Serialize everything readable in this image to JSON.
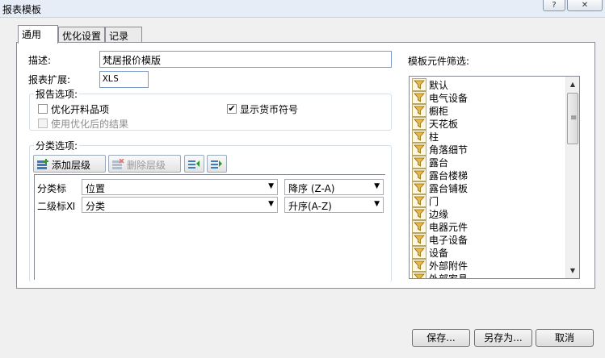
{
  "window": {
    "title": "报表模板",
    "help_button": "?",
    "close_button": "✕"
  },
  "tabs": [
    {
      "label": "通用"
    },
    {
      "label": "优化设置"
    },
    {
      "label": "记录"
    }
  ],
  "general": {
    "description_label": "描述:",
    "description_value": "梵居报价模版",
    "extension_label": "报表扩展:",
    "extension_value": "XLS",
    "report_options": {
      "title": "报告选项:",
      "optimize_items": {
        "label": "优化开料品项",
        "checked": false
      },
      "show_currency": {
        "label": "显示货币符号",
        "checked": true
      },
      "use_optimized": {
        "label": "使用优化后的结果",
        "checked": false,
        "enabled": false
      }
    },
    "category_options": {
      "title": "分类选项:",
      "add_level": "添加层级",
      "delete_level": "删除层级",
      "rows": [
        {
          "label": "分类标",
          "field": "位置",
          "sort": "降序 (Z-A)"
        },
        {
          "label": "二级标Ⅺ",
          "field": "分类",
          "sort": "升序(A-Z)"
        }
      ]
    }
  },
  "component_filter": {
    "title": "模板元件筛选:",
    "items": [
      "默认",
      "电气设备",
      "橱柜",
      "天花板",
      "柱",
      "角落细节",
      "露台",
      "露台楼梯",
      "露台铺板",
      "门",
      "边缘",
      "电器元件",
      "电子设备",
      "设备",
      "外部附件",
      "外部家具"
    ]
  },
  "footer": {
    "save": "保存...",
    "save_as": "另存为...",
    "cancel": "取消"
  },
  "icons": {
    "help": "question-mark-icon",
    "close": "close-icon",
    "add": "add-level-icon",
    "delete": "delete-level-icon",
    "move_up": "move-up-icon",
    "move_down": "move-down-icon",
    "filter": "filter-funnel-icon",
    "check": "checkmark-icon",
    "dropdown": "dropdown-arrow-icon"
  },
  "colors": {
    "title_bar": "#e6edf6",
    "panel": "#ffffff",
    "window": "#f0f0f0",
    "icon_gold": "#e8b84a"
  }
}
